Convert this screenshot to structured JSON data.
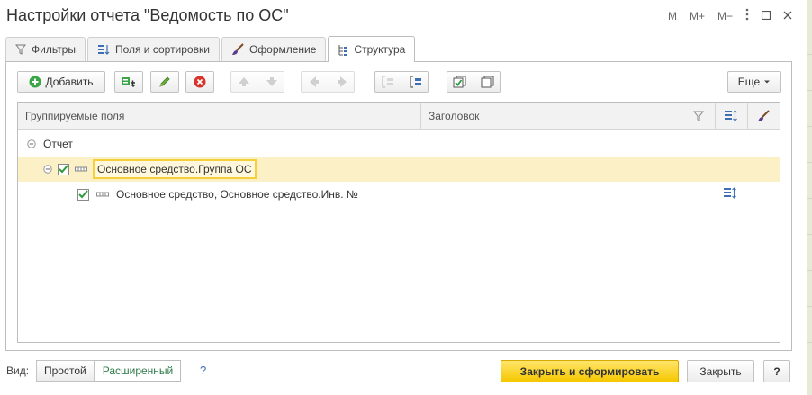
{
  "window": {
    "title": "Настройки отчета \"Ведомость по ОС\"",
    "buttons": {
      "m": "M",
      "m_plus": "M+",
      "m_minus": "M−"
    }
  },
  "tabs": [
    {
      "label": "Фильтры",
      "icon": "filter-icon"
    },
    {
      "label": "Поля и сортировки",
      "icon": "fields-sort-icon"
    },
    {
      "label": "Оформление",
      "icon": "brush-icon"
    },
    {
      "label": "Структура",
      "icon": "structure-icon",
      "active": true
    }
  ],
  "toolbar": {
    "add_label": "Добавить",
    "more_label": "Еще"
  },
  "grid": {
    "columns": {
      "grouping_fields": "Группируемые поля",
      "header": "Заголовок"
    },
    "rows": [
      {
        "label": "Отчет",
        "level": 0,
        "expanded": true
      },
      {
        "label": "Основное средство.Группа ОС",
        "level": 1,
        "checked": true,
        "expanded": true,
        "selected": true
      },
      {
        "label": "Основное средство, Основное средство.Инв. №",
        "level": 2,
        "checked": true,
        "has_sort": true
      }
    ]
  },
  "footer": {
    "view_label": "Вид:",
    "simple": "Простой",
    "extended": "Расширенный",
    "active_view": "Расширенный",
    "help": "?",
    "close_generate": "Закрыть и сформировать",
    "close": "Закрыть",
    "question": "?"
  },
  "colors": {
    "accent_yellow": "#f5c700",
    "selection_row": "#fbf0c6",
    "active_view_text": "#2f7a4a",
    "add_icon_green": "#3ba648",
    "delete_icon_red": "#d9342b"
  }
}
